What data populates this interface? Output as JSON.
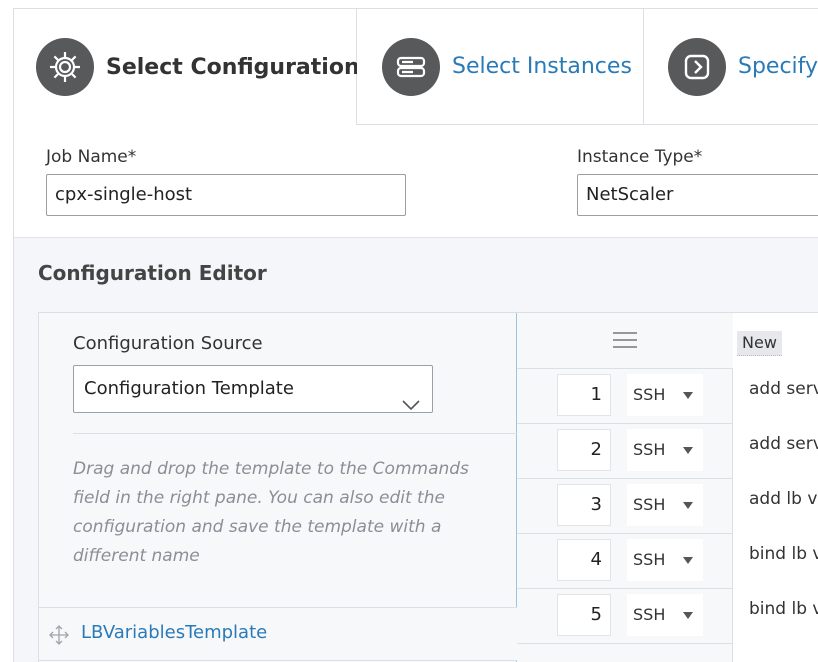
{
  "tabs": [
    {
      "label": "Select Configuration",
      "icon": "gear-icon",
      "active": true
    },
    {
      "label": "Select Instances",
      "icon": "server-icon",
      "active": false
    },
    {
      "label": "Specify V",
      "icon": "chevron-right-icon",
      "active": false
    }
  ],
  "form": {
    "job_name_label": "Job Name*",
    "job_name_value": "cpx-single-host",
    "instance_type_label": "Instance Type*",
    "instance_type_value": "NetScaler"
  },
  "editor": {
    "title": "Configuration Editor",
    "source_label": "Configuration Source",
    "source_value": "Configuration Template",
    "hint": "Drag and drop the template to the Commands field in the right pane. You can also edit the configuration and save the template with a different name",
    "templates": [
      "LBVariablesTemplate"
    ],
    "new_badge": "New",
    "commands": [
      {
        "num": "1",
        "protocol": "SSH",
        "text": "add serv"
      },
      {
        "num": "2",
        "protocol": "SSH",
        "text": "add serv"
      },
      {
        "num": "3",
        "protocol": "SSH",
        "text": "add lb v"
      },
      {
        "num": "4",
        "protocol": "SSH",
        "text": "bind lb v"
      },
      {
        "num": "5",
        "protocol": "SSH",
        "text": "bind lb v"
      }
    ]
  },
  "colors": {
    "link": "#2a7ab8",
    "icon_bg": "#58595b",
    "pane_border": "#9cc4e4"
  }
}
